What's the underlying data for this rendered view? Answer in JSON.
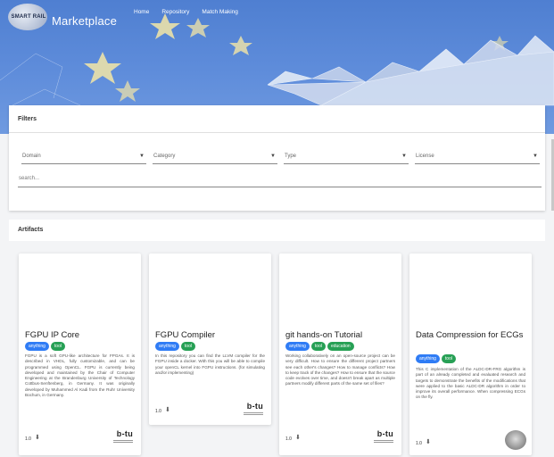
{
  "header": {
    "logo_text": "SMART RAIL",
    "brand": "Marketplace",
    "nav": [
      "Home",
      "Repository",
      "Match Making"
    ]
  },
  "filters": {
    "title": "Filters",
    "domain": "Domain",
    "category": "Category",
    "type": "Type",
    "license": "License",
    "search_placeholder": "search..."
  },
  "artifacts": {
    "title": "Artifacts",
    "cards": [
      {
        "title": "FGPU IP Core",
        "tags": [
          "anything",
          "tool"
        ],
        "description": "FGPU is a soft GPU-like architecture for FPGAs. It is described in VHDL, fully customizable, and can be programmed using OpenCL. FGPU is currently being developed and maintained by the Chair of Computer Engineering at the Brandenburg University of Technology Cottbus-Senftenberg, in Germany. It was originally developed by Muhammed Al Kadi from the Ruhr University Bochum, in Germany.",
        "version": "1.0",
        "logo": "b-tu"
      },
      {
        "title": "FGPU Compiler",
        "tags": [
          "anything",
          "tool"
        ],
        "description": "In this repository you can find the LLVM compiler for the FGPU inside a docker. With this you will be able to compile your openCL kernel into FGPU instructions. (for simulating and/or implementing)",
        "version": "1.0",
        "logo": "b-tu"
      },
      {
        "title": "git hands-on Tutorial",
        "tags": [
          "anything",
          "tool",
          "education"
        ],
        "description": "Working collaboratively on an open-source project can be very difficult. How to ensure the different project partners see each other's changes? How to manage conflicts? How to keep track of the changes? How to ensure that the source code evolves over time, and doesn't break apart as multiple partners modify different parts of the same set of files?",
        "version": "1.0",
        "logo": "b-tu"
      },
      {
        "title": "Data Compression for ECGs",
        "tags": [
          "anything",
          "tool"
        ],
        "description": "This C implementation of the ALDC-DR-FRG algorithm is part of an already completed and evaluated research and targets to demonstrate the benefits of the modifications that were applied to the basic ALDC-DR algorithm in order to improve its overall performance. When compressing ECGs on the fly.",
        "version": "1.0",
        "logo": "robot"
      }
    ]
  },
  "colors": {
    "hero": "#5f8ddb",
    "tag_blue": "#2f7cf5",
    "tag_green": "#27a055"
  }
}
